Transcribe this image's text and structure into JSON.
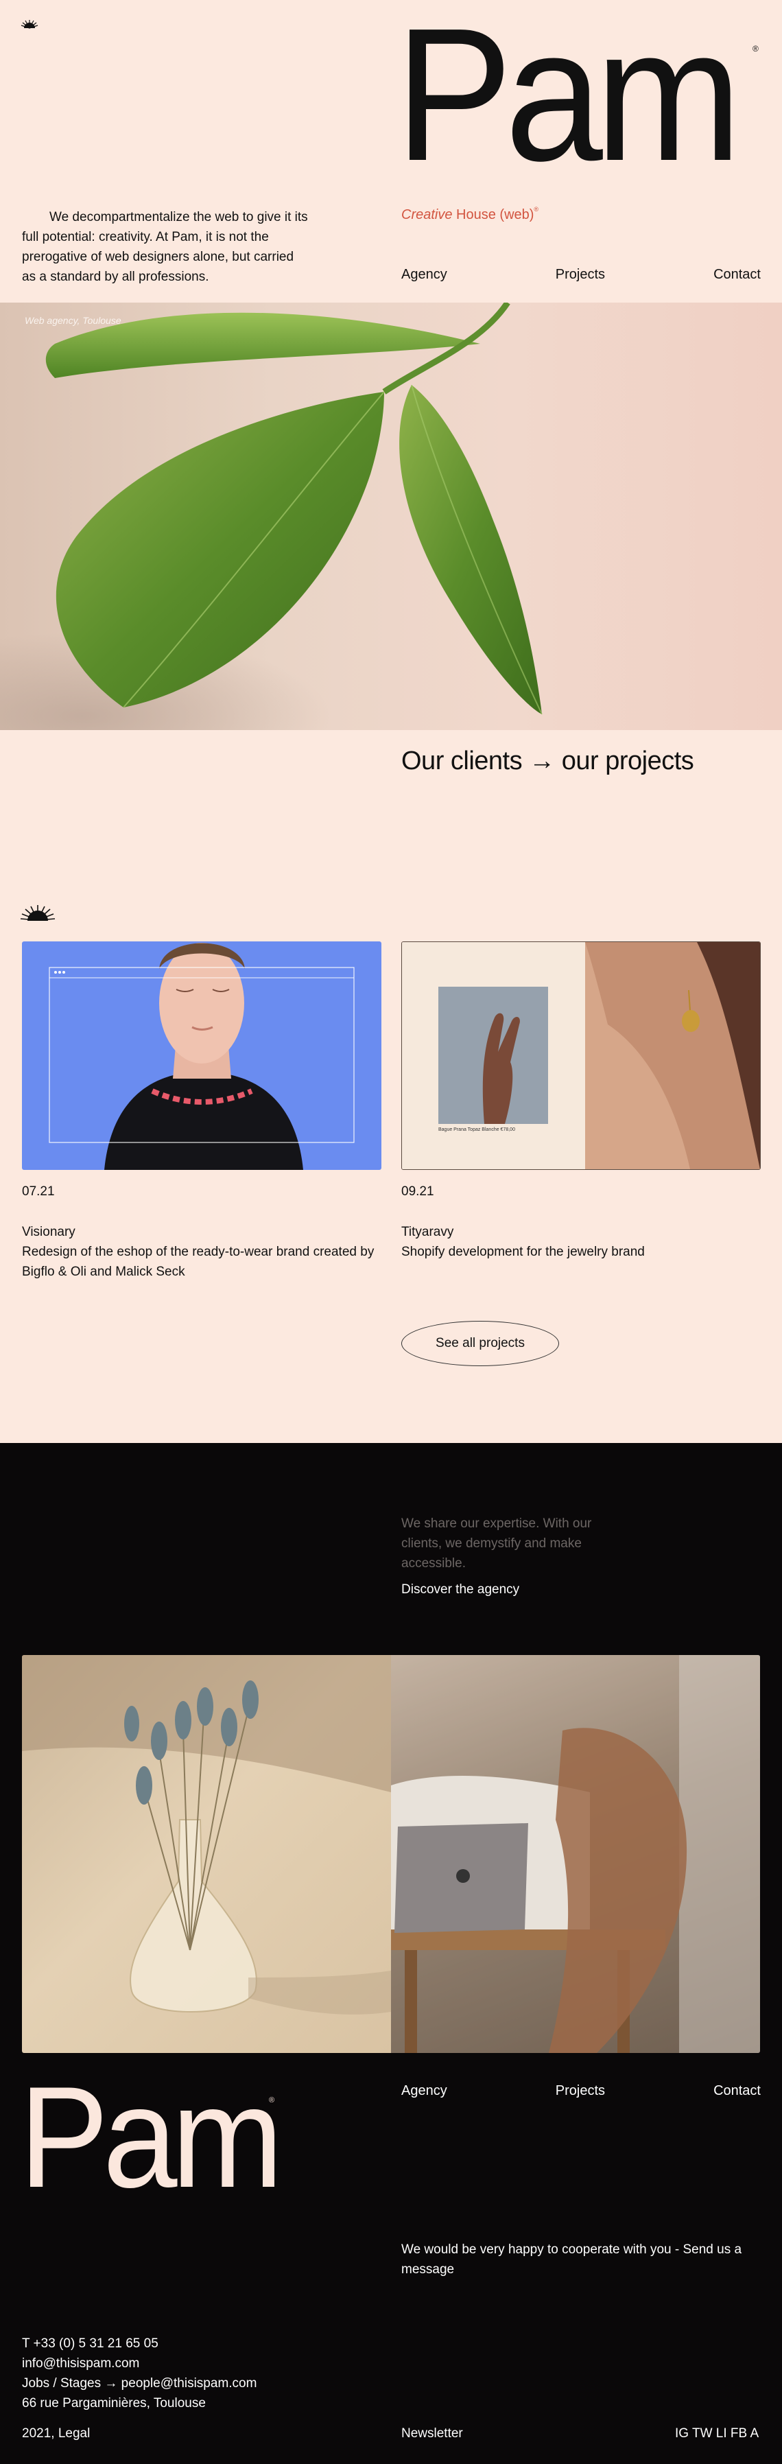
{
  "brand": {
    "logo": "Pam",
    "reg": "®",
    "tagline_italic": "Creative",
    "tagline_rest": " House (web)",
    "tagline_sup": "®"
  },
  "intro": "We decompartmentalize the web to give it its full potential: creativity. At Pam, it is not the prerogative of web designers alone, but carried as a standard by all professions.",
  "nav": {
    "agency": "Agency",
    "projects": "Projects",
    "contact": "Contact"
  },
  "hero": {
    "caption": "Web agency, Toulouse"
  },
  "clients": {
    "title": "Our clients → our projects",
    "projects": [
      {
        "date": "07.21",
        "name": "Visionary",
        "description": "Redesign of the eshop of the ready-to-wear brand created by Bigflo & Oli and Malick Seck"
      },
      {
        "date": "09.21",
        "name": "Tityaravy",
        "description": "Shopify development for the jewelry brand"
      }
    ],
    "card2_small_text": "Bague Prana Topaz Blanche   €78,00",
    "see_all": "See all projects"
  },
  "agency": {
    "expertise": "We share our expertise. With our clients, we demystify and make accessible.",
    "discover": "Discover the agency"
  },
  "footer": {
    "logo": "Pam",
    "reg": "®",
    "nav": {
      "agency": "Agency",
      "projects": "Projects",
      "contact": "Contact"
    },
    "cooperate": "We would be very happy to cooperate with you - Send us a message",
    "contact": {
      "phone": "T +33 (0) 5 31 21 65 05",
      "email": "info@thisispam.com",
      "jobs": "Jobs / Stages → people@thisispam.com",
      "address": "66 rue Pargaminières, Toulouse"
    },
    "legal": "2021, Legal",
    "newsletter": "Newsletter",
    "social": "IG TW LI FB A"
  },
  "colors": {
    "background": "#fce9df",
    "accent": "#d2543f",
    "dark": "#0a0809",
    "card_blue": "#6a8cf0"
  }
}
